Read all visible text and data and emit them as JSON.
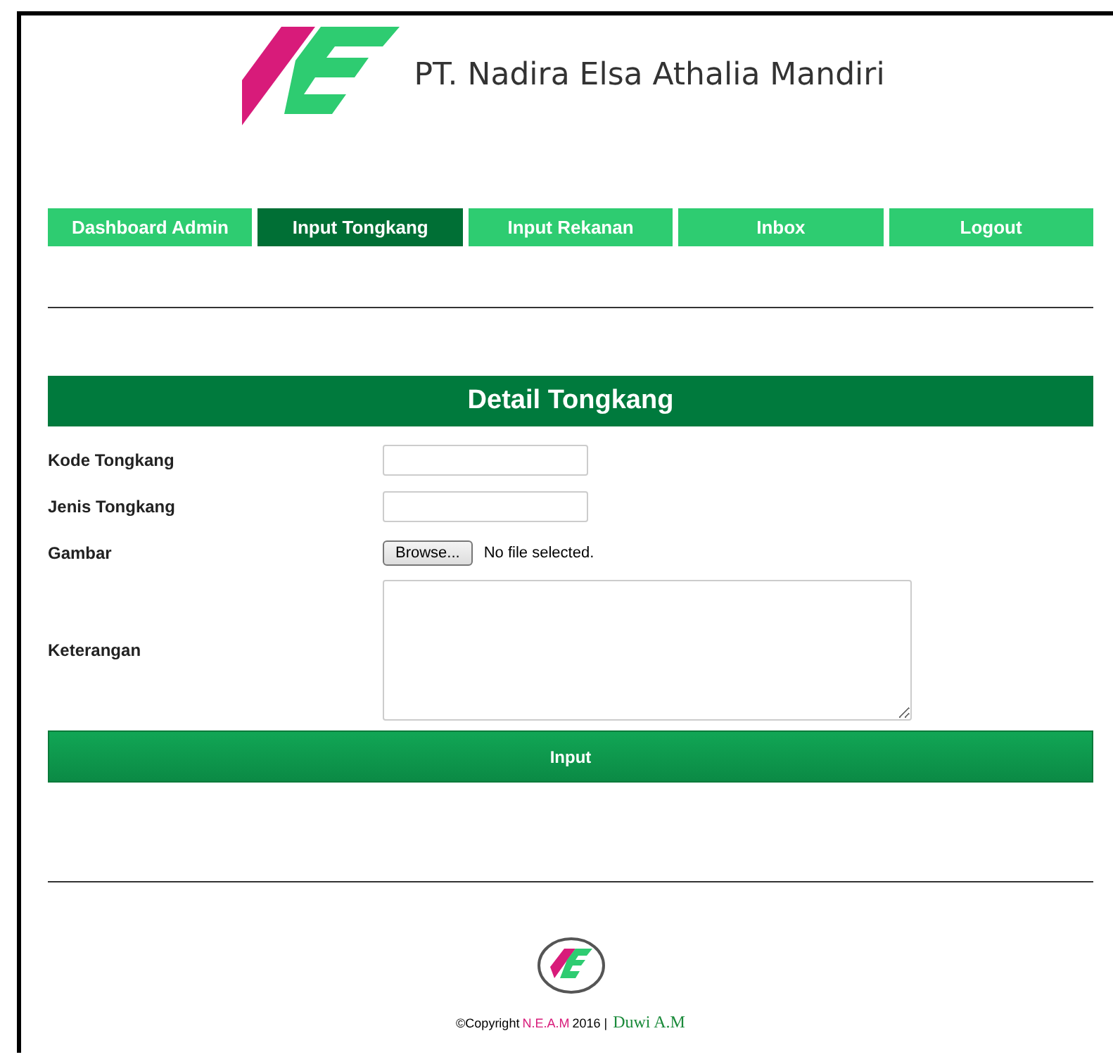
{
  "header": {
    "company": "PT. Nadira Elsa Athalia Mandiri"
  },
  "nav": [
    {
      "label": "Dashboard Admin",
      "selected": false
    },
    {
      "label": "Input Tongkang",
      "selected": true
    },
    {
      "label": "Input Rekanan",
      "selected": false
    },
    {
      "label": "Inbox",
      "selected": false
    },
    {
      "label": "Logout",
      "selected": false
    }
  ],
  "form": {
    "title": "Detail Tongkang",
    "fields": [
      {
        "kind": "text",
        "label": "Kode Tongkang"
      },
      {
        "kind": "text",
        "label": "Jenis Tongkang"
      },
      {
        "kind": "file",
        "label": "Gambar",
        "button": "Browse...",
        "status": "No file selected."
      },
      {
        "kind": "textarea",
        "label": "Keterangan"
      }
    ],
    "submit": "Input"
  },
  "footer": {
    "copyright": "©Copyright",
    "brand": "N.E.A.M",
    "year": "2016 |",
    "author": "Duwi A.M"
  }
}
